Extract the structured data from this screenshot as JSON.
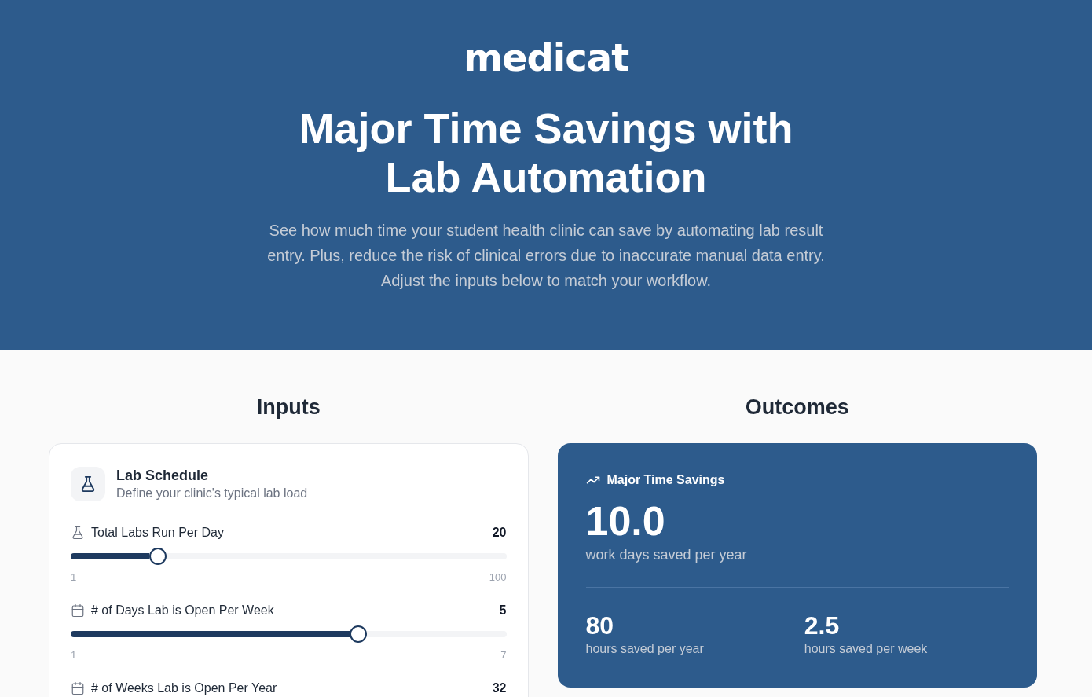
{
  "header": {
    "logo": "medicat",
    "title": "Major Time Savings with Lab Automation",
    "description": "See how much time your student health clinic can save by automating lab result entry. Plus, reduce the risk of clinical errors due to inaccurate manual data entry. Adjust the inputs below to match your workflow."
  },
  "inputs": {
    "heading": "Inputs",
    "card": {
      "title": "Lab Schedule",
      "subtitle": "Define your clinic's typical lab load",
      "sliders": [
        {
          "label": "Total Labs Run Per Day",
          "value": "20",
          "level": 0.2,
          "min": "1",
          "max": "100"
        },
        {
          "label": "# of Days Lab is Open Per Week",
          "value": "5",
          "level": 0.66,
          "min": "1",
          "max": "7"
        },
        {
          "label": "# of Weeks Lab is Open Per Year",
          "value": "32"
        }
      ]
    }
  },
  "outcomes": {
    "heading": "Outcomes",
    "card": {
      "title": "Major Time Savings",
      "main_value": "10.0",
      "main_caption": "work days saved per year",
      "stats": [
        {
          "value": "80",
          "caption": "hours saved per year"
        },
        {
          "value": "2.5",
          "caption": "hours saved per week"
        }
      ]
    }
  }
}
